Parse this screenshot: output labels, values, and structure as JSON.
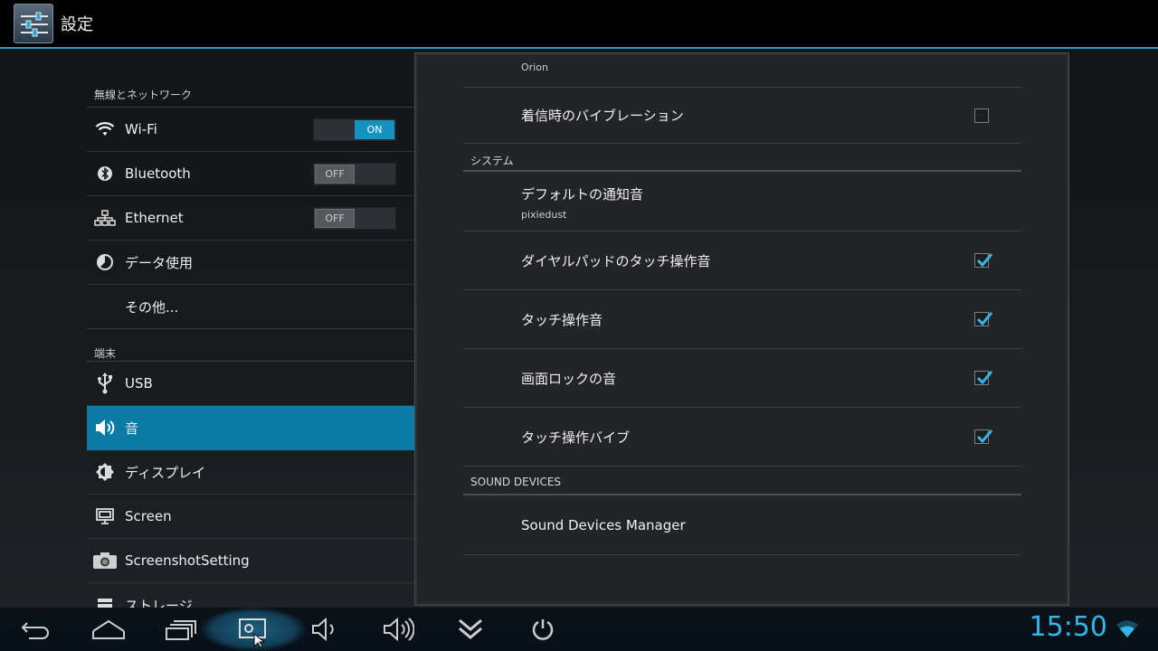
{
  "app": {
    "title": "設定"
  },
  "left": {
    "categories": [
      {
        "header": "無線とネットワーク"
      },
      {
        "header": "端末"
      }
    ],
    "items": [
      {
        "label": "Wi-Fi",
        "icon": "wifi-icon",
        "toggle": "ON"
      },
      {
        "label": "Bluetooth",
        "icon": "bluetooth-icon",
        "toggle": "OFF"
      },
      {
        "label": "Ethernet",
        "icon": "ethernet-icon",
        "toggle": "OFF"
      },
      {
        "label": "データ使用",
        "icon": "data-usage-icon"
      },
      {
        "label": "その他..."
      },
      {
        "label": "USB",
        "icon": "usb-icon"
      },
      {
        "label": "音",
        "icon": "volume-icon",
        "selected": true
      },
      {
        "label": "ディスプレイ",
        "icon": "brightness-icon"
      },
      {
        "label": "Screen",
        "icon": "monitor-icon"
      },
      {
        "label": "ScreenshotSetting",
        "icon": "camera-icon"
      },
      {
        "label": "ストレージ",
        "icon": "storage-icon"
      }
    ]
  },
  "right": {
    "ringtone_summary": "Orion",
    "vibrate_on_ring": {
      "title": "着信時のバイブレーション",
      "checked": false
    },
    "system_header": "システム",
    "default_notification": {
      "title": "デフォルトの通知音",
      "summary": "pixiedust"
    },
    "dialpad_tones": {
      "title": "ダイヤルパッドのタッチ操作音",
      "checked": true
    },
    "touch_sounds": {
      "title": "タッチ操作音",
      "checked": true
    },
    "screen_lock_sound": {
      "title": "画面ロックの音",
      "checked": true
    },
    "haptic_feedback": {
      "title": "タッチ操作バイブ",
      "checked": true
    },
    "sound_devices_header": "SOUND DEVICES",
    "sound_devices_manager": {
      "title": "Sound Devices Manager"
    }
  },
  "navbar": {
    "buttons": [
      "back-icon",
      "home-icon",
      "recents-icon",
      "screenshot-icon",
      "volume-down-icon",
      "volume-up-icon",
      "collapse-icon",
      "power-icon"
    ],
    "clock": "15:50",
    "accent": "#33b5e5"
  }
}
